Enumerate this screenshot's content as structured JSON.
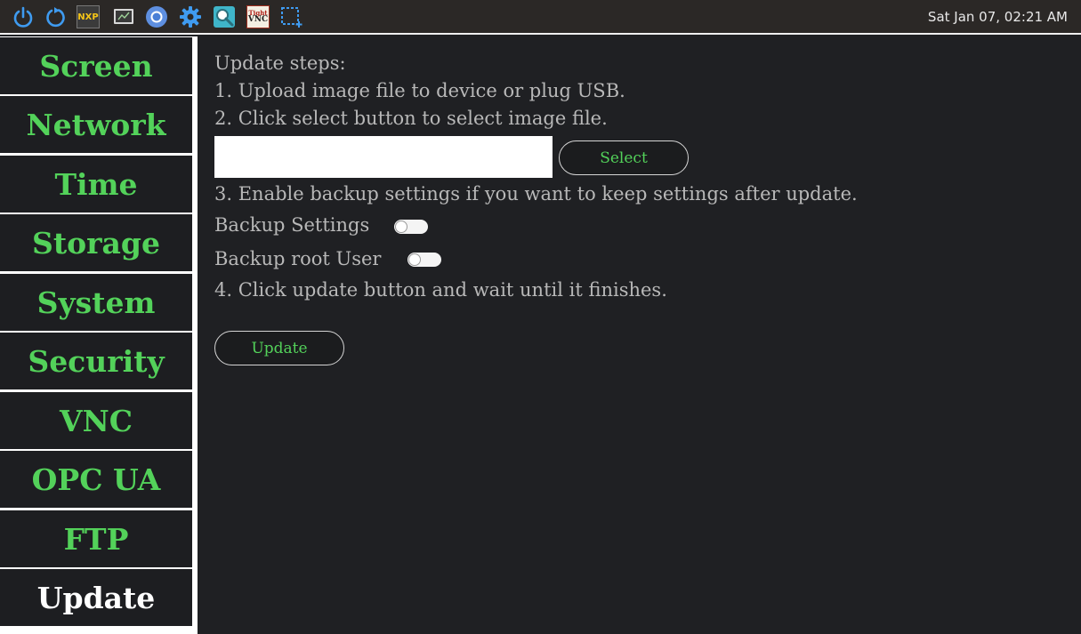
{
  "taskbar": {
    "icons": [
      "power-icon",
      "restart-icon",
      "nxp-logo-icon",
      "terminal-icon",
      "chromium-icon",
      "settings-gear-icon",
      "magnifier-icon",
      "vnc-viewer-icon",
      "screenshot-select-icon"
    ],
    "clock": "Sat Jan 07, 02:21 AM",
    "nxp_text": "NXP",
    "vnc_text_top": "Tight",
    "vnc_text_bottom": "VNC"
  },
  "sidebar": {
    "items": [
      {
        "label": "Screen"
      },
      {
        "label": "Network"
      },
      {
        "label": "Time"
      },
      {
        "label": "Storage"
      },
      {
        "label": "System"
      },
      {
        "label": "Security"
      },
      {
        "label": "VNC"
      },
      {
        "label": "OPC UA"
      },
      {
        "label": "FTP"
      },
      {
        "label": "Update"
      }
    ],
    "active": "Update"
  },
  "main": {
    "heading": "Update steps:",
    "step1": "1. Upload image file to device or plug USB.",
    "step2": "2. Click select button to select image file.",
    "file_value": "",
    "select_label": "Select",
    "step3": "3. Enable backup settings if you want to keep settings after update.",
    "backup_settings_label": "Backup Settings",
    "backup_settings_on": false,
    "backup_root_label": "Backup root User",
    "backup_root_on": false,
    "step4": "4. Click update button and wait until it finishes.",
    "update_label": "Update"
  },
  "colors": {
    "accent_green": "#53d25a",
    "background": "#1f2023",
    "taskbar": "#2b2826"
  }
}
